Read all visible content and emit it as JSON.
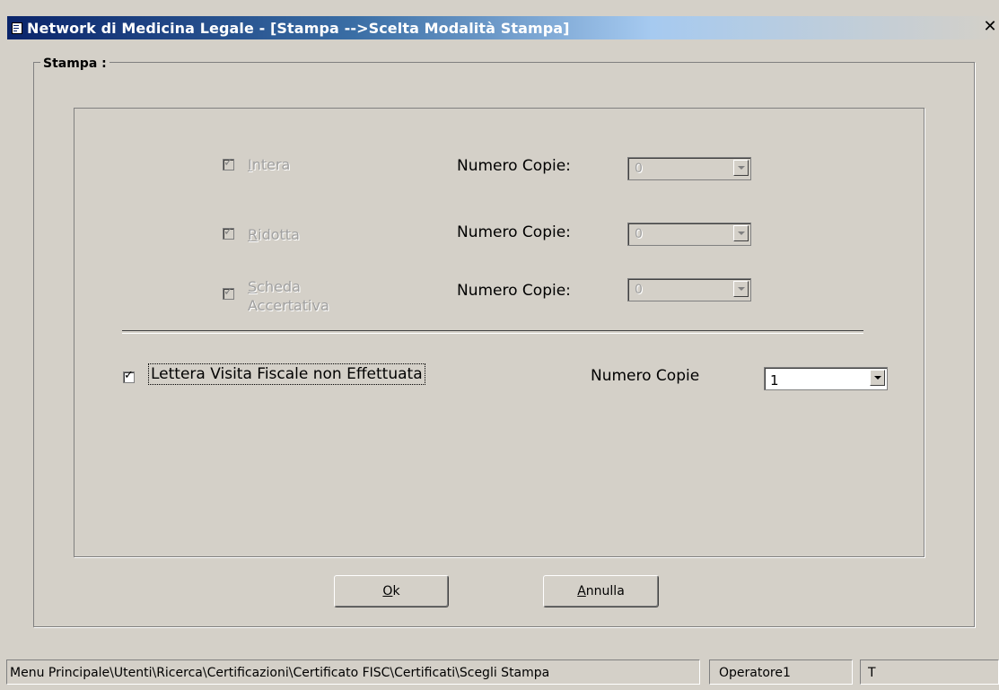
{
  "window": {
    "title": "Network di Medicina Legale - [Stampa -->Scelta Modalità Stampa]",
    "close_glyph": "✕"
  },
  "group": {
    "legend": "Stampa :"
  },
  "rows": [
    {
      "checkbox_label_rest": "ntera",
      "checkbox_label_hotkey": "I",
      "checked": true,
      "enabled": false,
      "copies_label": "Numero Copie:",
      "copies_value": "0"
    },
    {
      "checkbox_label_rest": "idotta",
      "checkbox_label_hotkey": "R",
      "checked": true,
      "enabled": false,
      "copies_label": "Numero Copie:",
      "copies_value": "0"
    },
    {
      "checkbox_label_line1_rest": "cheda",
      "checkbox_label_hotkey": "S",
      "checkbox_label_line2": "Accertativa",
      "checked": true,
      "enabled": false,
      "copies_label": "Numero Copie:",
      "copies_value": "0"
    }
  ],
  "lettera": {
    "label": "Lettera Visita Fiscale non Effettuata",
    "checked": true,
    "copies_label": "Numero Copie",
    "copies_value": "1"
  },
  "buttons": {
    "ok_hotkey": "O",
    "ok_rest": "k",
    "cancel_hotkey": "A",
    "cancel_rest": "nnulla"
  },
  "statusbar": {
    "path": "Menu Principale\\Utenti\\Ricerca\\Certificazioni\\Certificato FISC\\Certificati\\Scegli Stampa",
    "operator": "Operatore1",
    "extra": "T"
  },
  "check_glyph": "✓",
  "icons": [
    "app-window-icon",
    "close-icon",
    "checkbox-check-icon",
    "dropdown-arrow-icon"
  ]
}
